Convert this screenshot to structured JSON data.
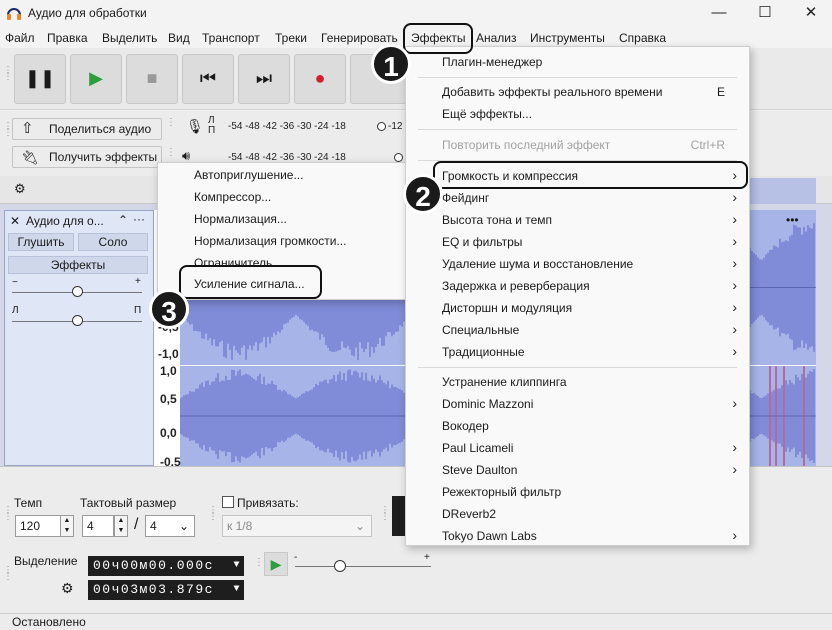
{
  "window": {
    "title": "Аудио для обработки",
    "minimize": "—",
    "maximize": "☐",
    "close": "✕"
  },
  "menubar": [
    "Файл",
    "Правка",
    "Выделить",
    "Вид",
    "Транспорт",
    "Треки",
    "Генерировать",
    "Эффекты",
    "Анализ",
    "Инструменты",
    "Справка"
  ],
  "toolbar": {
    "share_audio": "Поделиться аудио",
    "get_effects": "Получить эффекты",
    "meter_scale": "-54 -48 -42 -36 -30 -24 -18",
    "meter_scale_tail": "-12",
    "meter_scale_tail2": "-"
  },
  "track": {
    "name": "Аудио для о...",
    "mute": "Глушить",
    "solo": "Соло",
    "effects": "Эффекты",
    "gain_minus": "−",
    "gain_plus": "+",
    "pan_left": "Л",
    "pan_right": "П",
    "more": "···"
  },
  "waveform_axis": [
    "-0,5",
    "-1,0",
    "1,0",
    "0,5",
    "0,0",
    "-0,5"
  ],
  "effects_menu": {
    "items": [
      {
        "label": "Плагин-менеджер"
      },
      {
        "label": "Добавить эффекты реального времени",
        "shortcut": "E"
      },
      {
        "label": "Ещё эффекты..."
      },
      {
        "label": "Повторить последний эффект",
        "shortcut": "Ctrl+R",
        "disabled": true
      },
      {
        "label": "Громкость и компрессия",
        "submenu": true
      },
      {
        "label": "Фейдинг",
        "submenu": true
      },
      {
        "label": "Высота тона и темп",
        "submenu": true
      },
      {
        "label": "EQ и фильтры",
        "submenu": true
      },
      {
        "label": "Удаление шума и восстановление",
        "submenu": true
      },
      {
        "label": "Задержка и реверберация",
        "submenu": true
      },
      {
        "label": "Дисторшн и модуляция",
        "submenu": true
      },
      {
        "label": "Специальные",
        "submenu": true
      },
      {
        "label": "Традиционные",
        "submenu": true
      },
      {
        "label": "Устранение клиппинга"
      },
      {
        "label": "Dominic Mazzoni",
        "submenu": true
      },
      {
        "label": "Вокодер"
      },
      {
        "label": "Paul Licameli",
        "submenu": true
      },
      {
        "label": "Steve Daulton",
        "submenu": true
      },
      {
        "label": "Режекторный фильтр"
      },
      {
        "label": "DReverb2"
      },
      {
        "label": "Tokyo Dawn Labs",
        "submenu": true
      }
    ]
  },
  "volume_submenu": {
    "items": [
      "Автоприглушение...",
      "Компрессор...",
      "Нормализация...",
      "Нормализация громкости...",
      "Ограничитель...",
      "Усиление сигнала..."
    ]
  },
  "annotations": {
    "step1": "1",
    "step2": "2",
    "step3": "3"
  },
  "bottom": {
    "tempo_label": "Темп",
    "tempo_value": "120",
    "time_sig_label": "Тактовый размер",
    "time_sig_num": "4",
    "time_sig_sep": "/",
    "time_sig_den": "4",
    "snap_label": "Привязать:",
    "snap_value": "к 1/8",
    "selection_label": "Выделение",
    "sel_start": "00ч00м00.000с",
    "sel_end": "00ч03м03.879с",
    "slider_minus": "-",
    "slider_plus": "+"
  },
  "status": "Остановлено",
  "colors": {
    "waveform": "#5a63c9",
    "waveform_bg": "#a6b4e8",
    "record": "#d31f2c",
    "play": "#2e9e3d",
    "clip_marker": "#c0386a"
  }
}
